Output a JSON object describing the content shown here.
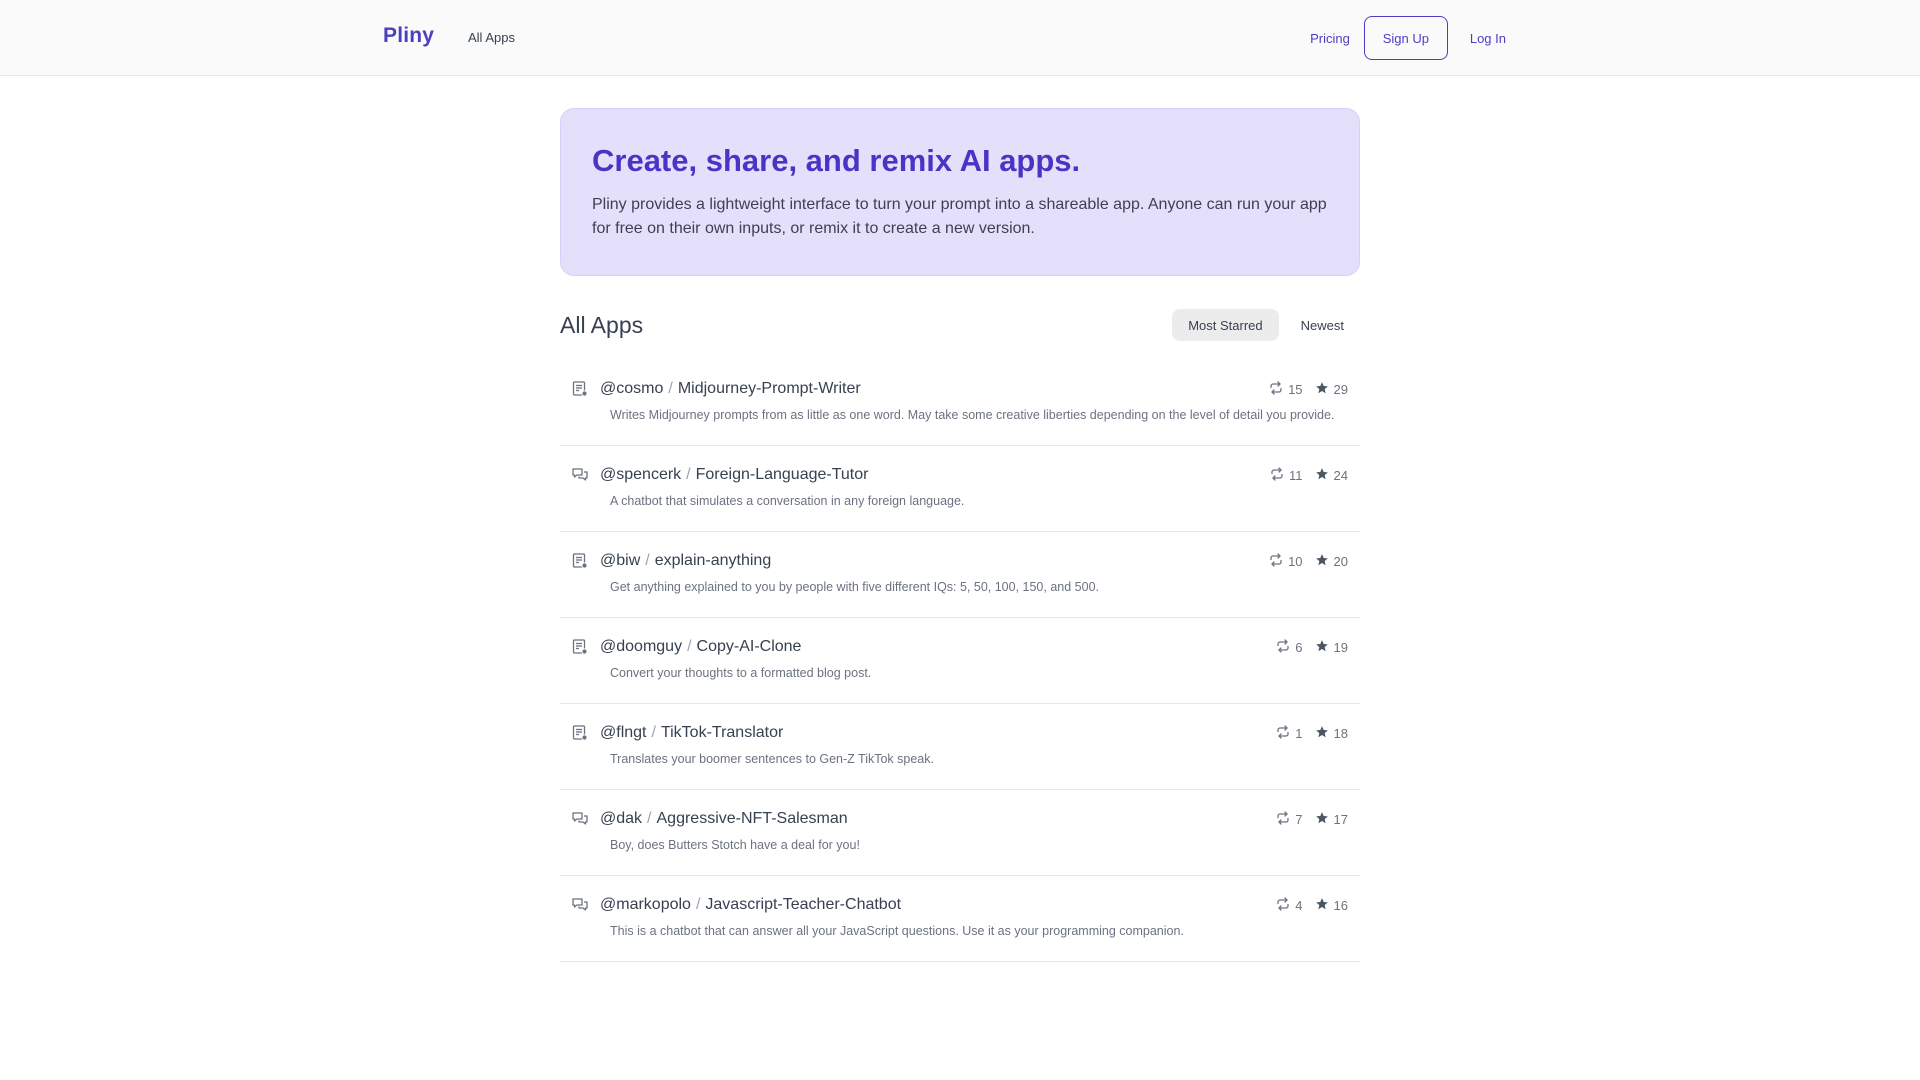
{
  "header": {
    "brand": "Pliny",
    "nav_all_apps": "All Apps",
    "pricing": "Pricing",
    "sign_up": "Sign Up",
    "log_in": "Log In"
  },
  "hero": {
    "title": "Create, share, and remix AI apps.",
    "text": "Pliny provides a lightweight interface to turn your prompt into a shareable app. Anyone can run your app for free on their own inputs, or remix it to create a new version."
  },
  "apps_section": {
    "title": "All Apps",
    "sort_most_starred": "Most Starred",
    "sort_newest": "Newest"
  },
  "apps": [
    {
      "icon": "document-icon",
      "user": "@cosmo",
      "name": "Midjourney-Prompt-Writer",
      "remixes": "15",
      "stars": "29",
      "description": "Writes Midjourney prompts from as little as one word. May take some creative liberties depending on the level of detail you provide."
    },
    {
      "icon": "chat-icon",
      "user": "@spencerk",
      "name": "Foreign-Language-Tutor",
      "remixes": "11",
      "stars": "24",
      "description": "A chatbot that simulates a conversation in any foreign language."
    },
    {
      "icon": "document-icon",
      "user": "@biw",
      "name": "explain-anything",
      "remixes": "10",
      "stars": "20",
      "description": "Get anything explained to you by people with five different IQs: 5, 50, 100, 150, and 500."
    },
    {
      "icon": "document-icon",
      "user": "@doomguy",
      "name": "Copy-AI-Clone",
      "remixes": "6",
      "stars": "19",
      "description": "Convert your thoughts to a formatted blog post."
    },
    {
      "icon": "document-icon",
      "user": "@flngt",
      "name": "TikTok-Translator",
      "remixes": "1",
      "stars": "18",
      "description": "Translates your boomer sentences to Gen-Z TikTok speak."
    },
    {
      "icon": "chat-icon",
      "user": "@dak",
      "name": "Aggressive-NFT-Salesman",
      "remixes": "7",
      "stars": "17",
      "description": "Boy, does Butters Stotch have a deal for you!"
    },
    {
      "icon": "chat-icon",
      "user": "@markopolo",
      "name": "Javascript-Teacher-Chatbot",
      "remixes": "4",
      "stars": "16",
      "description": "This is a chatbot that can answer all your JavaScript questions. Use it as your programming companion."
    }
  ]
}
